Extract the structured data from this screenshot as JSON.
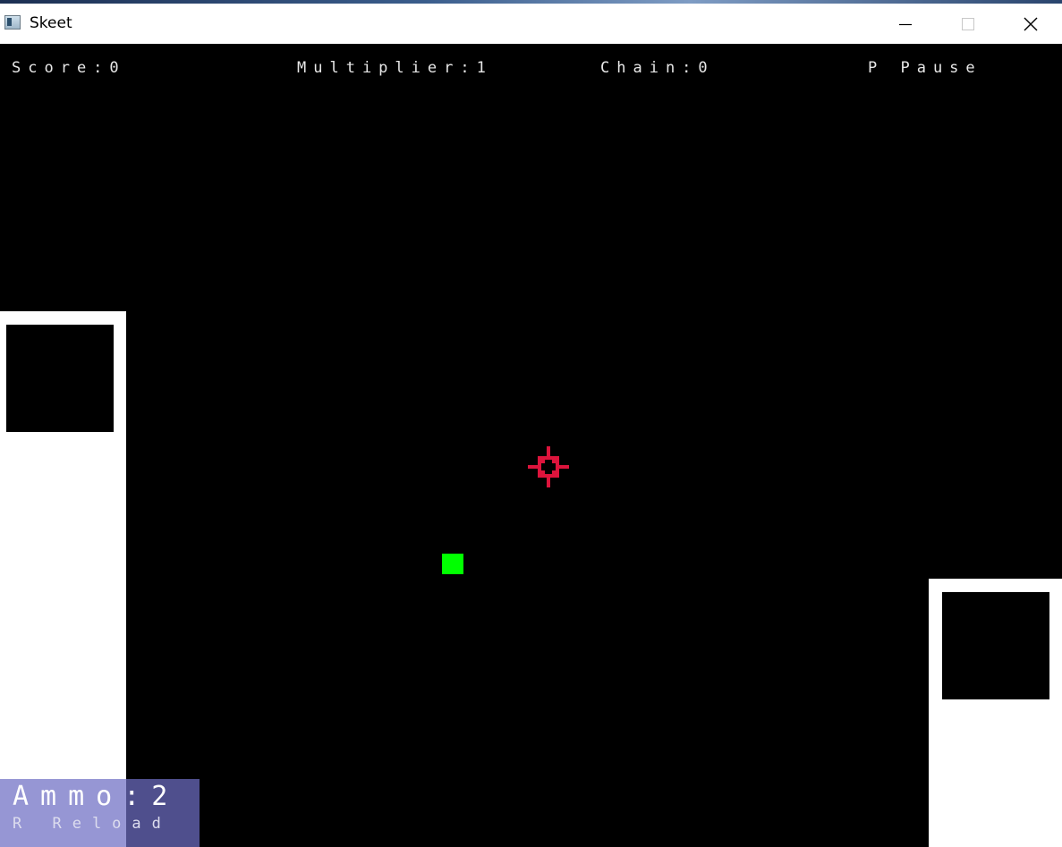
{
  "window": {
    "title": "Skeet",
    "icon": "app-window-icon",
    "controls": [
      "minimize-icon",
      "maximize-icon",
      "close-icon"
    ]
  },
  "hud": {
    "score": "Score:0",
    "multiplier": "Multiplier:1",
    "chain": "Chain:0",
    "pause_hint": "P Pause"
  },
  "ammo": {
    "label": "Ammo:2",
    "reload_hint": "R Reload"
  },
  "colors": {
    "background": "#000000",
    "skeet": "#00ff00",
    "crosshair": "#dc143c",
    "house": "#ffffff",
    "ammo_panel": "#6e6ec3"
  }
}
